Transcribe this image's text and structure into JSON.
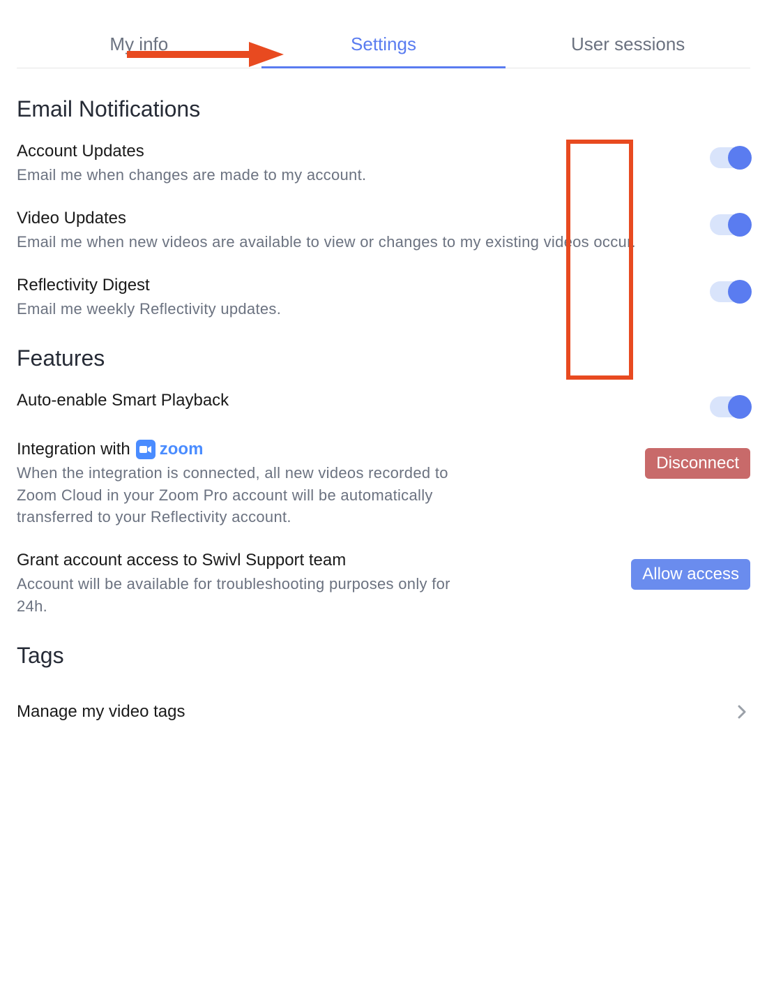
{
  "tabs": {
    "my_info": "My info",
    "settings": "Settings",
    "user_sessions": "User sessions"
  },
  "sections": {
    "email_notifications": {
      "heading": "Email Notifications",
      "account_updates": {
        "title": "Account Updates",
        "desc": "Email me when changes are made to my account."
      },
      "video_updates": {
        "title": "Video Updates",
        "desc": "Email me when new videos are available to view or changes to my existing videos occur."
      },
      "reflectivity_digest": {
        "title": "Reflectivity Digest",
        "desc": "Email me weekly Reflectivity updates."
      }
    },
    "features": {
      "heading": "Features",
      "smart_playback": {
        "title": "Auto-enable Smart Playback"
      },
      "zoom_integration": {
        "title_prefix": "Integration with",
        "zoom_label": "zoom",
        "desc": "When the integration is connected, all new videos recorded to Zoom Cloud in your Zoom Pro account will be automatically transferred to your Reflectivity account.",
        "button": "Disconnect"
      },
      "grant_access": {
        "title": "Grant account access to Swivl Support team",
        "desc": "Account will be available for troubleshooting purposes only for 24h.",
        "button": "Allow access"
      }
    },
    "tags": {
      "heading": "Tags",
      "manage": "Manage my video tags"
    }
  },
  "annotations": {
    "arrow_color": "#e84a20",
    "highlight_color": "#e84a20"
  }
}
